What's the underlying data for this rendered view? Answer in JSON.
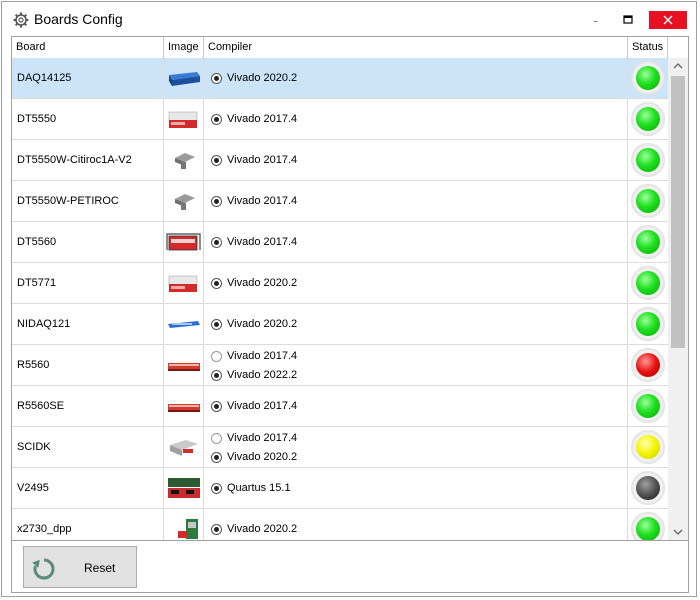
{
  "window": {
    "title": "Boards Config"
  },
  "table": {
    "headers": {
      "board": "Board",
      "image": "Image",
      "compiler": "Compiler",
      "status": "Status"
    },
    "rows": [
      {
        "board": "DAQ14125",
        "image_icon": "board-rack-blue-icon",
        "compilers": [
          {
            "label": "Vivado 2020.2",
            "selected": true
          }
        ],
        "status": "green",
        "selected_row": true
      },
      {
        "board": "DT5550",
        "image_icon": "board-desktop-red-icon",
        "compilers": [
          {
            "label": "Vivado 2017.4",
            "selected": true
          }
        ],
        "status": "green"
      },
      {
        "board": "DT5550W-Citiroc1A-V2",
        "image_icon": "board-mezzanine-gray-icon",
        "compilers": [
          {
            "label": "Vivado 2017.4",
            "selected": true
          }
        ],
        "status": "green"
      },
      {
        "board": "DT5550W-PETIROC",
        "image_icon": "board-mezzanine-gray-icon",
        "compilers": [
          {
            "label": "Vivado 2017.4",
            "selected": true
          }
        ],
        "status": "green"
      },
      {
        "board": "DT5560",
        "image_icon": "board-handle-red-icon",
        "compilers": [
          {
            "label": "Vivado 2017.4",
            "selected": true
          }
        ],
        "status": "green"
      },
      {
        "board": "DT5771",
        "image_icon": "board-desktop-red-icon",
        "compilers": [
          {
            "label": "Vivado 2020.2",
            "selected": true
          }
        ],
        "status": "green"
      },
      {
        "board": "NIDAQ121",
        "image_icon": "board-flat-blue-icon",
        "compilers": [
          {
            "label": "Vivado 2020.2",
            "selected": true
          }
        ],
        "status": "green"
      },
      {
        "board": "R5560",
        "image_icon": "board-rack-red-icon",
        "compilers": [
          {
            "label": "Vivado 2017.4",
            "selected": false
          },
          {
            "label": "Vivado 2022.2",
            "selected": true
          }
        ],
        "status": "red"
      },
      {
        "board": "R5560SE",
        "image_icon": "board-rack-red-icon",
        "compilers": [
          {
            "label": "Vivado 2017.4",
            "selected": true
          }
        ],
        "status": "green"
      },
      {
        "board": "SCIDK",
        "image_icon": "board-small-gray-icon",
        "compilers": [
          {
            "label": "Vivado 2017.4",
            "selected": false
          },
          {
            "label": "Vivado 2020.2",
            "selected": true
          }
        ],
        "status": "yellow"
      },
      {
        "board": "V2495",
        "image_icon": "board-vme-red-icon",
        "compilers": [
          {
            "label": "Quartus 15.1",
            "selected": true
          }
        ],
        "status": "gray"
      },
      {
        "board": "x2730_dpp",
        "image_icon": "board-module-green-icon",
        "compilers": [
          {
            "label": "Vivado 2020.2",
            "selected": true
          }
        ],
        "status": "green"
      }
    ]
  },
  "footer": {
    "reset_label": "Reset"
  },
  "colors": {
    "selection": "#cce4f7",
    "close_button": "#e81123",
    "led_green": "#1fe01f",
    "led_red": "#e81010",
    "led_yellow": "#f4f400",
    "led_gray": "#4a4a4a"
  }
}
